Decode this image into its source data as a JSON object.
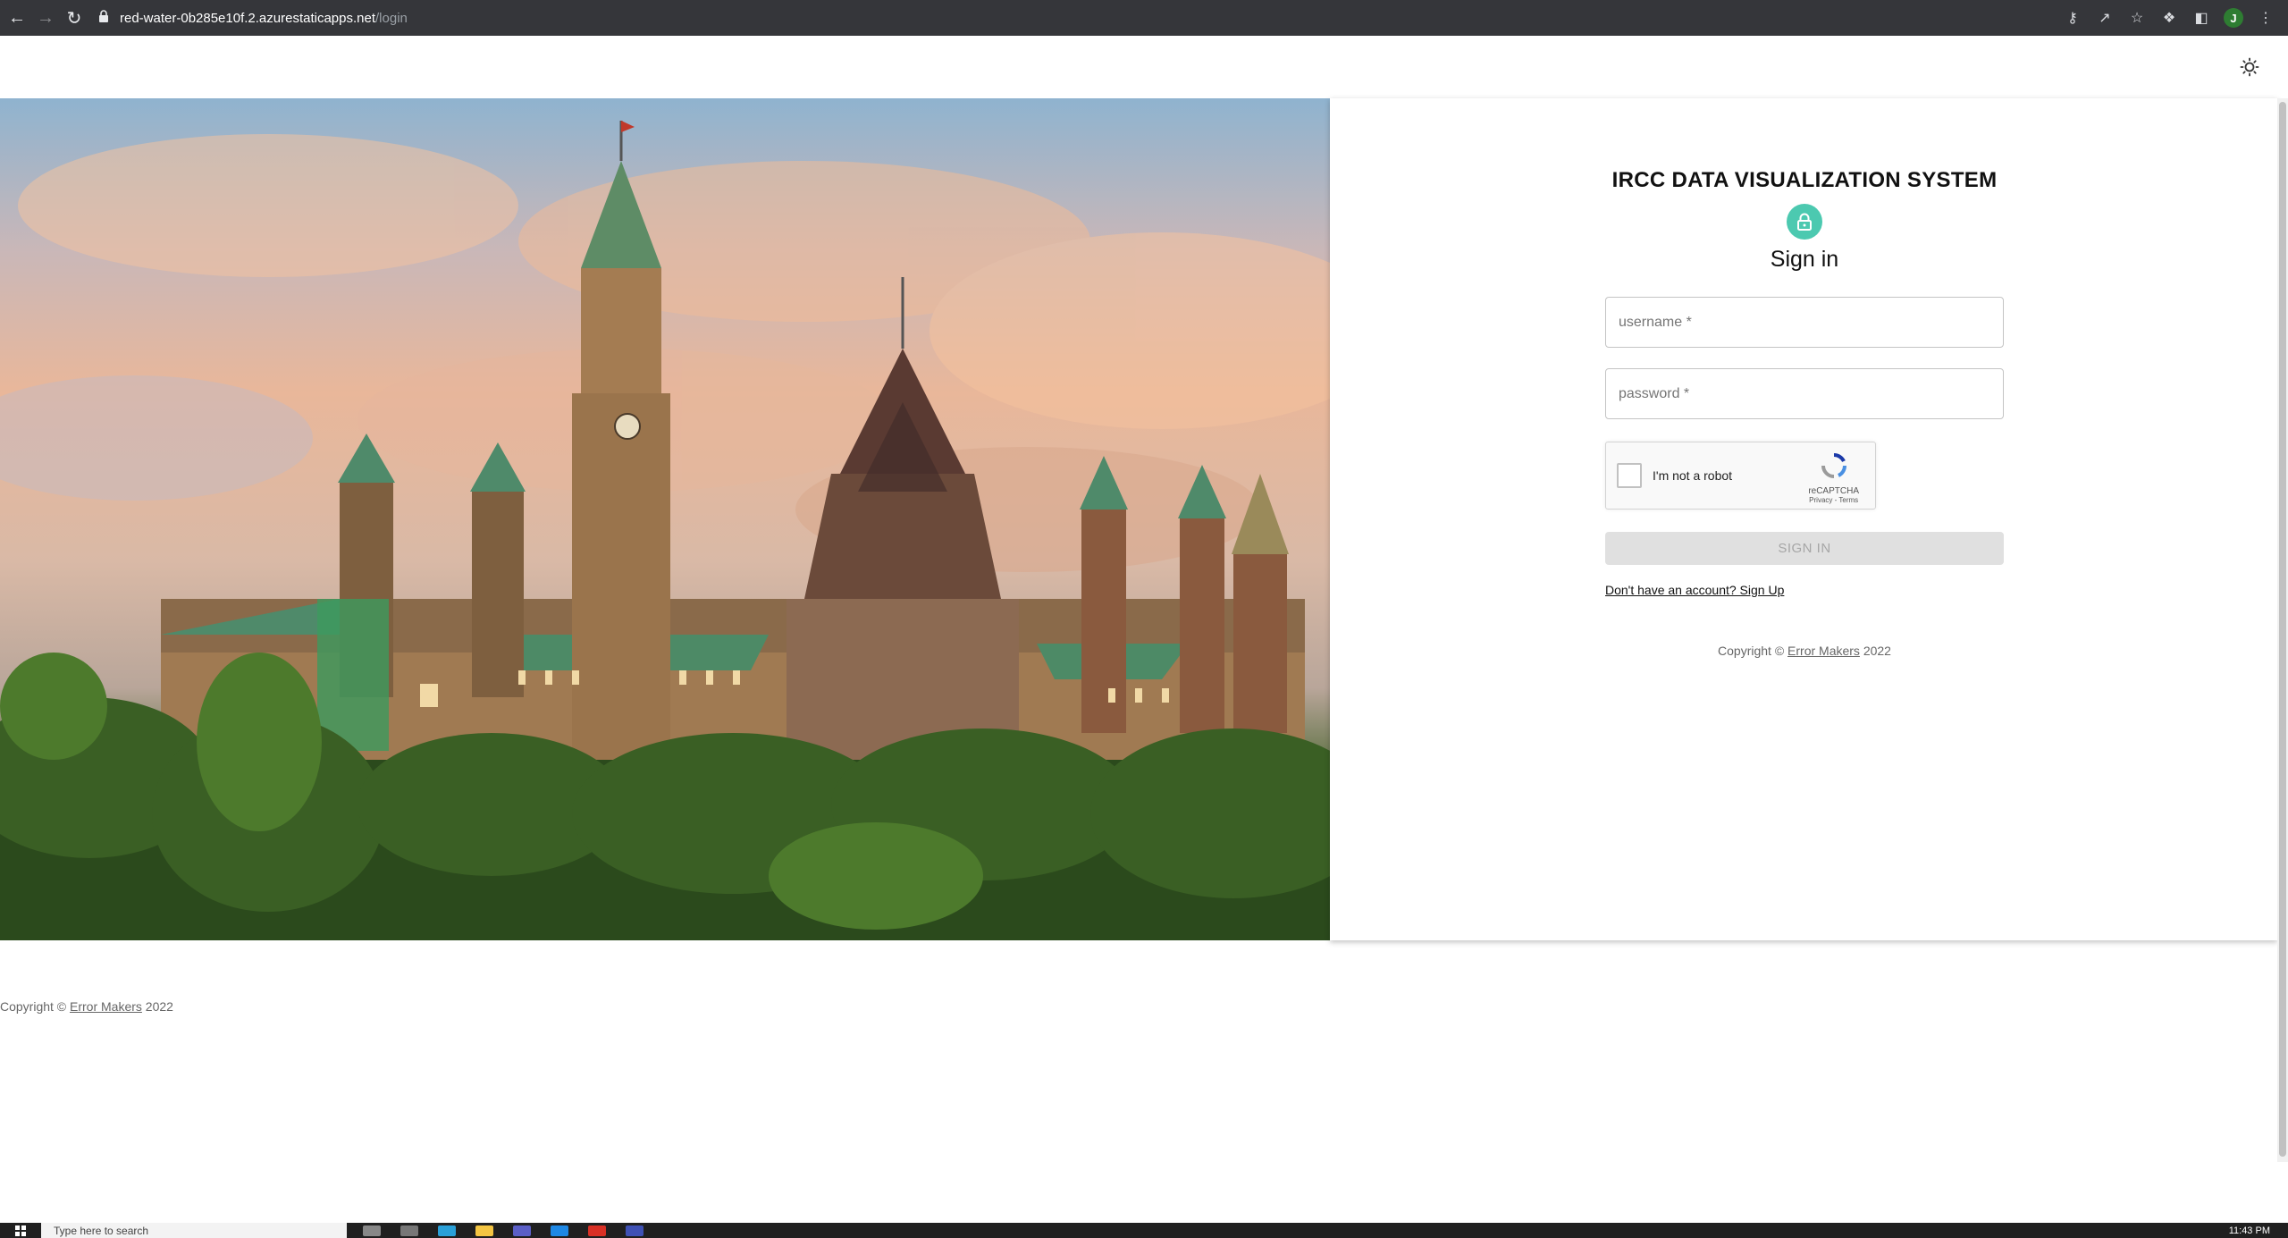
{
  "browser": {
    "url_host": "red-water-0b285e10f.2.azurestaticapps.net",
    "url_path": "/login",
    "profile_initial": "J"
  },
  "hero": {
    "image_alt": "Parliament Hill, Ottawa"
  },
  "login": {
    "system_title": "IRCC DATA VISUALIZATION SYSTEM",
    "heading": "Sign in",
    "username_placeholder": "username *",
    "password_placeholder": "password *",
    "captcha_label": "I'm not a robot",
    "captcha_brand": "reCAPTCHA",
    "captcha_links": "Privacy - Terms",
    "signin_button": "SIGN IN",
    "signup_link": "Don't have an account? Sign Up"
  },
  "copyright": {
    "prefix": "Copyright © ",
    "link": "Error Makers",
    "suffix": " 2022"
  },
  "taskbar": {
    "search_placeholder": "Type here to search",
    "clock": "11:43 PM"
  },
  "colors": {
    "accent_teal": "#4cc9b0",
    "disabled_button": "#e0e0e0",
    "chrome_bar": "#35363a"
  }
}
